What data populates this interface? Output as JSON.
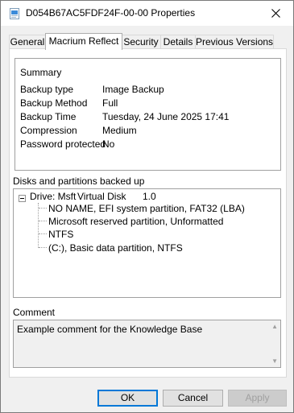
{
  "window": {
    "title": "D054B67AC5FDF24F-00-00 Properties"
  },
  "tabs": [
    {
      "label": "General"
    },
    {
      "label": "Macrium Reflect"
    },
    {
      "label": "Security"
    },
    {
      "label": "Details"
    },
    {
      "label": "Previous Versions"
    }
  ],
  "summary": {
    "heading": "Summary",
    "rows": [
      {
        "label": "Backup type",
        "value": "Image Backup"
      },
      {
        "label": "Backup Method",
        "value": "Full"
      },
      {
        "label": "Backup Time",
        "value": "Tuesday, 24 June 2025 17:41"
      },
      {
        "label": "Compression",
        "value": "Medium"
      },
      {
        "label": "Password protected",
        "value": "No"
      }
    ]
  },
  "disks": {
    "label": "Disks and partitions backed up",
    "drive": {
      "name": "Drive: Msft",
      "type": "Virtual Disk",
      "size": "1.0"
    },
    "partitions": [
      "NO NAME, EFI system partition, FAT32 (LBA)",
      "Microsoft reserved partition, Unformatted",
      "NTFS",
      "(C:), Basic data partition, NTFS"
    ]
  },
  "comment": {
    "label": "Comment",
    "text": "Example comment for the Knowledge Base"
  },
  "buttons": {
    "ok": "OK",
    "cancel": "Cancel",
    "apply": "Apply"
  },
  "icons": {
    "title": "file-properties-icon",
    "close": "close-icon",
    "expander": "tree-collapse-icon"
  }
}
